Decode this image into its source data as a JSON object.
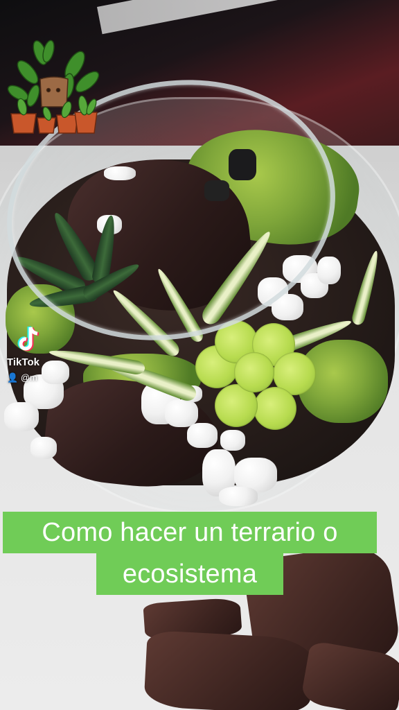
{
  "watermark": {
    "brand": "TikTok",
    "username": "@m"
  },
  "caption": {
    "line1": "Como hacer un terrario o",
    "line2": "ecosistema",
    "highlight_color": "#70cc57",
    "text_color": "#ffffff"
  },
  "icons": {
    "logo": "potted-plants-logo",
    "tiktok": "tiktok-logo-icon",
    "user": "user-icon"
  }
}
